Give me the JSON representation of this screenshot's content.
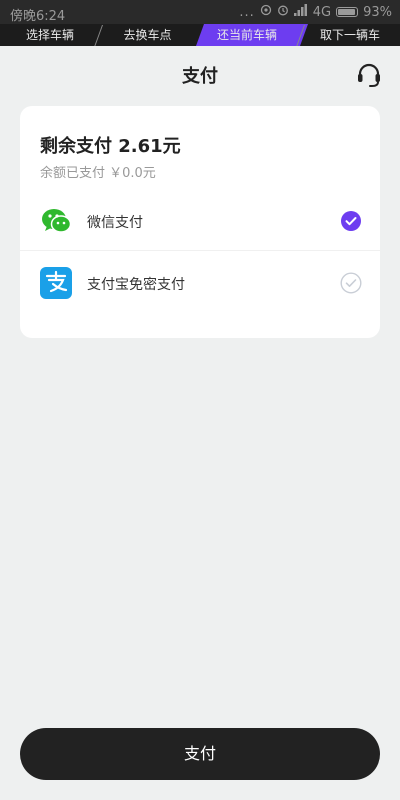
{
  "status_bar": {
    "time": "傍晚6:24",
    "dots": "...",
    "network": "4G",
    "battery": "93%"
  },
  "steps": [
    {
      "label": "选择车辆",
      "active": false
    },
    {
      "label": "去换车点",
      "active": false
    },
    {
      "label": "还当前车辆",
      "active": true
    },
    {
      "label": "取下一辆车",
      "active": false
    }
  ],
  "header": {
    "title": "支付",
    "headset_icon": "headset-icon"
  },
  "payment": {
    "remaining": "剩余支付 2.61元",
    "paid": "余额已支付 ￥0.0元",
    "options": [
      {
        "label": "微信支付",
        "icon": "wechat-icon",
        "selected": true
      },
      {
        "label": "支付宝免密支付",
        "icon": "alipay-icon",
        "selected": false
      }
    ]
  },
  "pay_button": {
    "label": "支付"
  },
  "colors": {
    "accent": "#6d3df0",
    "wechat": "#2fb82e",
    "alipay": "#1aa0e8",
    "button": "#222222",
    "background": "#eef0f0"
  }
}
